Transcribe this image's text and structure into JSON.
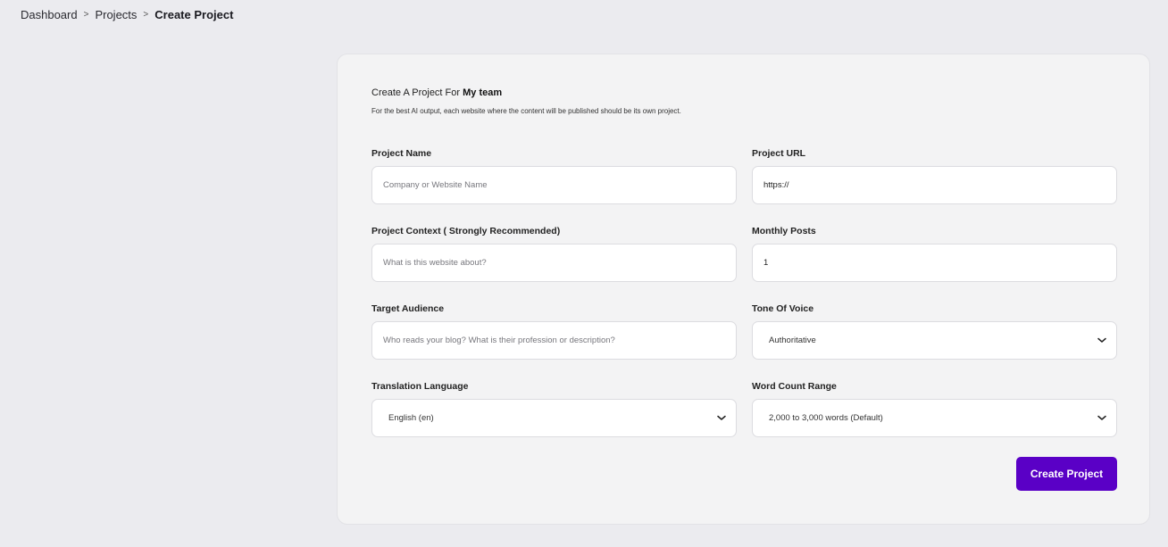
{
  "breadcrumb": {
    "items": [
      "Dashboard",
      "Projects",
      "Create Project"
    ],
    "separator": ">"
  },
  "card": {
    "title_prefix": "Create A Project For ",
    "team_name": "My team",
    "subtitle": "For the best AI output, each website where the content will be published should be its own project."
  },
  "fields": {
    "project_name": {
      "label": "Project Name",
      "value": "",
      "placeholder": "Company or Website Name"
    },
    "project_url": {
      "label": "Project URL",
      "value": "https://",
      "placeholder": ""
    },
    "project_context": {
      "label": "Project Context ( Strongly Recommended)",
      "value": "",
      "placeholder": "What is this website about?"
    },
    "monthly_posts": {
      "label": "Monthly Posts",
      "value": "1",
      "placeholder": ""
    },
    "target_audience": {
      "label": "Target Audience",
      "value": "",
      "placeholder": "Who reads your blog? What is their profession or description?"
    },
    "tone_of_voice": {
      "label": "Tone Of Voice",
      "selected": "Authoritative"
    },
    "translation_language": {
      "label": "Translation Language",
      "selected": "English (en)"
    },
    "word_count_range": {
      "label": "Word Count Range",
      "selected": "2,000 to 3,000 words (Default)"
    }
  },
  "actions": {
    "create_label": "Create Project"
  },
  "colors": {
    "accent": "#5a00c6",
    "page_bg": "#ebebef",
    "card_bg": "#f3f3f4"
  }
}
